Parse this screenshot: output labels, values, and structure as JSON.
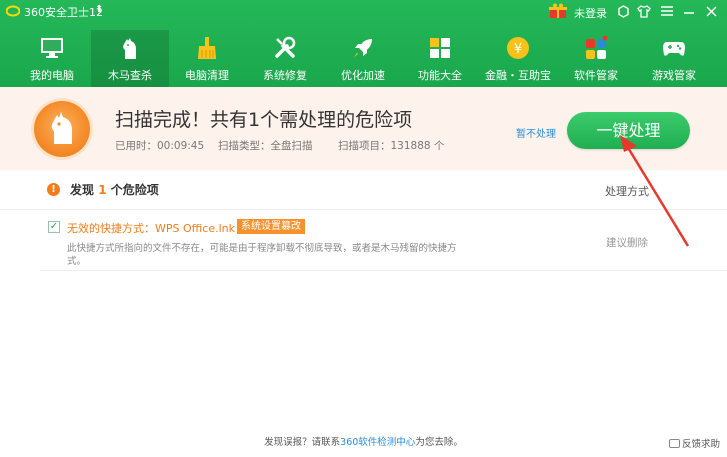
{
  "app": {
    "title": "360安全卫士12",
    "login": "未登录",
    "title_icons": [
      "gift-icon",
      "skin-icon",
      "shirt-icon",
      "menu-icon",
      "minimize-icon",
      "close-icon"
    ]
  },
  "nav": {
    "items": [
      {
        "label": "我的电脑",
        "icon": "monitor-icon"
      },
      {
        "label": "木马查杀",
        "icon": "horse-icon"
      },
      {
        "label": "电脑清理",
        "icon": "broom-icon"
      },
      {
        "label": "系统修复",
        "icon": "wrench-icon"
      },
      {
        "label": "优化加速",
        "icon": "rocket-icon"
      },
      {
        "label": "功能大全",
        "icon": "grid-icon"
      },
      {
        "label": "金融・互助宝",
        "icon": "coin-icon"
      },
      {
        "label": "软件管家",
        "icon": "apps-icon"
      },
      {
        "label": "游戏管家",
        "icon": "gamepad-icon"
      }
    ],
    "active_index": 1
  },
  "status": {
    "title": "扫描完成！共有1个需处理的危险项",
    "elapsed": "已用时：00:09:45",
    "scan_type": "扫描类型：全盘扫描",
    "scan_items": "扫描项目：131888 个",
    "pause_label": "暂不处理",
    "action_label": "一键处理"
  },
  "risks": {
    "found_prefix": "发现",
    "found_count": "1",
    "found_suffix": "个危险项",
    "column_label": "处理方式",
    "items": [
      {
        "title": "无效的快捷方式：WPS Office.lnk",
        "badge": "系统设置篡改",
        "description": "此快捷方式所指向的文件不存在，可能是由于程序卸载不彻底导致，或者是木马残留的快捷方式。",
        "action": "建议删除",
        "checked": true
      }
    ]
  },
  "footer": {
    "note_prefix": "发现误报？请联系",
    "note_link": "360软件检测中心",
    "note_suffix": "为您去除。",
    "feedback": "反馈求助"
  },
  "colors": {
    "brand_green": "#1fae51",
    "warning_orange": "#f27c1b",
    "link_blue": "#2a8cd7",
    "annotation_red": "#e8372c"
  }
}
